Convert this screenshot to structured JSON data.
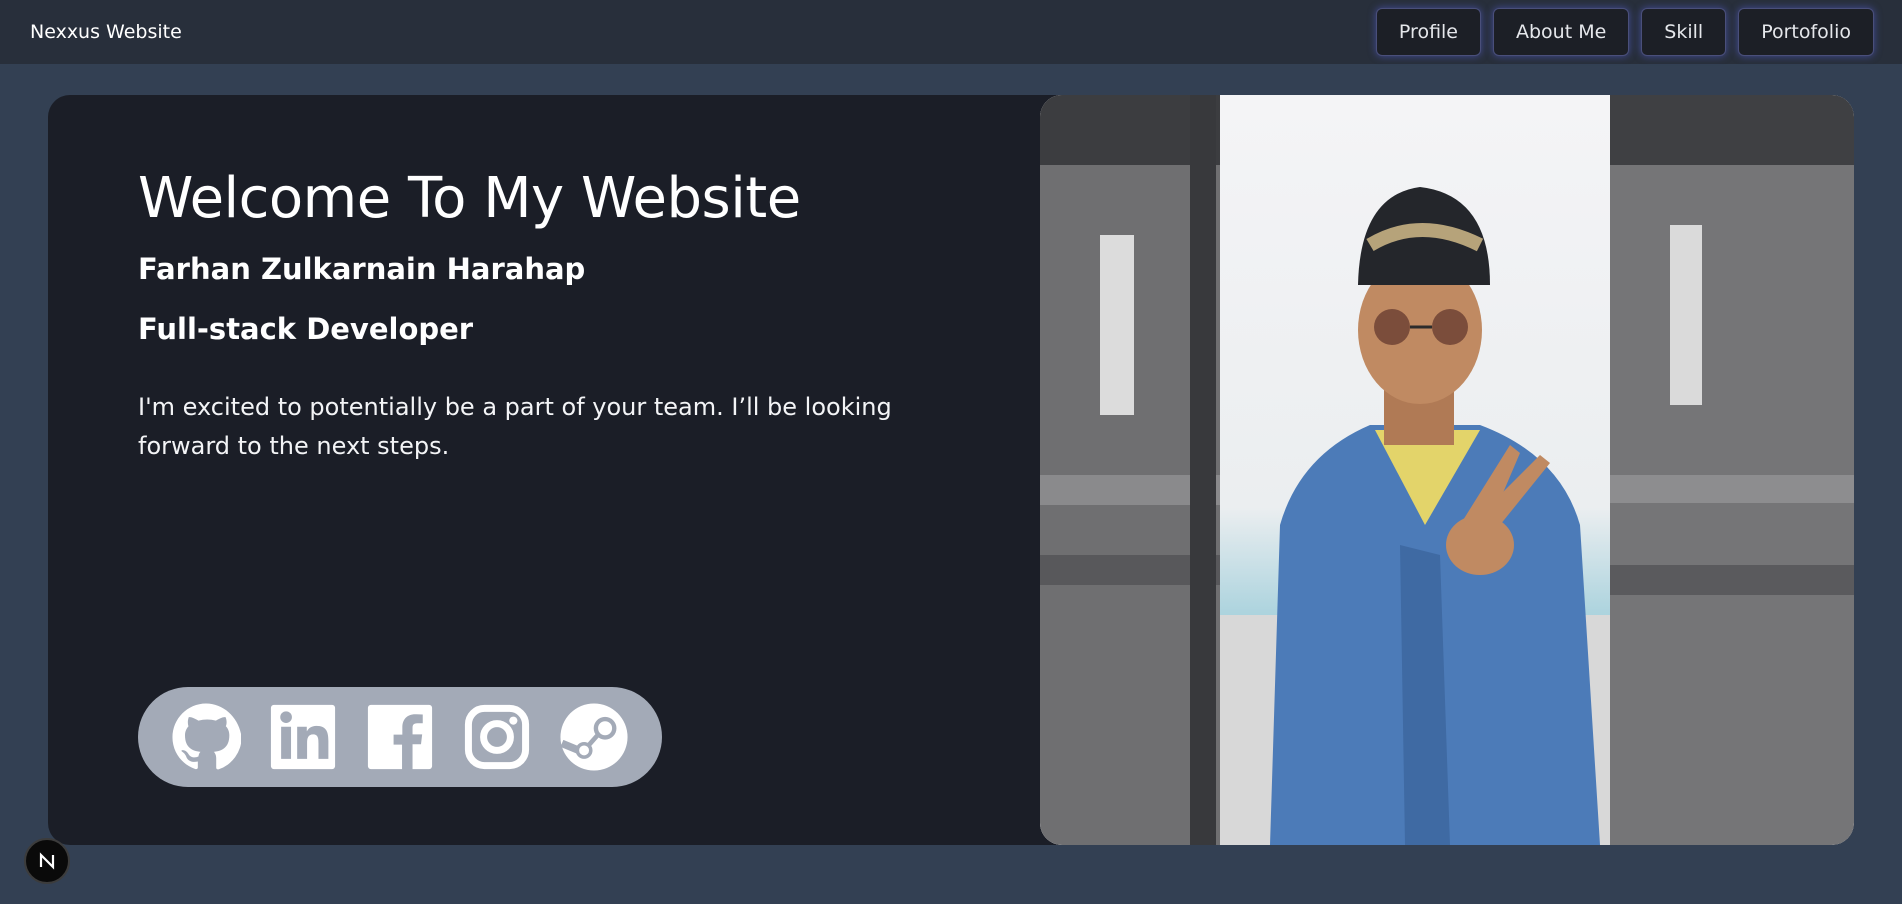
{
  "nav": {
    "brand": "Nexxus Website",
    "items": [
      {
        "label": "Profile"
      },
      {
        "label": "About Me"
      },
      {
        "label": "Skill"
      },
      {
        "label": "Portofolio"
      }
    ]
  },
  "hero": {
    "title": "Welcome To My Website",
    "name": "Farhan Zulkarnain Harahap",
    "role": "Full-stack Developer",
    "bio": "I'm excited to potentially be a part of your team. I’ll be looking forward to the next steps."
  },
  "socials": [
    {
      "icon": "github-icon"
    },
    {
      "icon": "linkedin-icon"
    },
    {
      "icon": "facebook-icon"
    },
    {
      "icon": "instagram-icon"
    },
    {
      "icon": "steam-icon"
    }
  ],
  "badge": {
    "letter": "N"
  },
  "colors": {
    "background": "#334053",
    "navbar": "#282f3b",
    "card": "#1b1e27",
    "social_bar": "#a3aab7",
    "nav_glow": "#5a64e6"
  }
}
